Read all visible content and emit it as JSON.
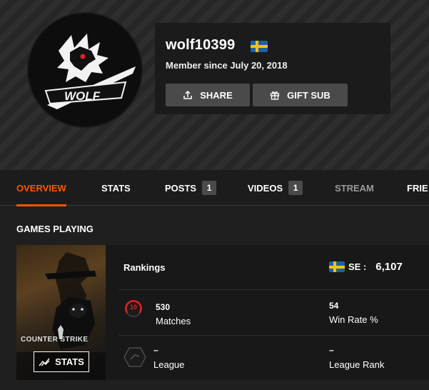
{
  "profile": {
    "username": "wolf10399",
    "member_since": "Member since July 20, 2018",
    "avatar_text": "WOLF",
    "country": "Sweden"
  },
  "actions": {
    "share_label": "SHARE",
    "gift_label": "GIFT SUB"
  },
  "tabs": [
    {
      "label": "OVERVIEW",
      "active": true
    },
    {
      "label": "STATS"
    },
    {
      "label": "POSTS",
      "badge": "1"
    },
    {
      "label": "VIDEOS",
      "badge": "1"
    },
    {
      "label": "STREAM"
    },
    {
      "label": "FRIE"
    }
  ],
  "section": {
    "games_playing": "GAMES PLAYING"
  },
  "game": {
    "cover_logo": "COUNTER STRIKE",
    "stats_label": "STATS",
    "rankings_label": "Rankings",
    "region_code": "SE :",
    "region_value": "6,107",
    "level": "10",
    "matches_value": "530",
    "matches_label": "Matches",
    "win_rate_value": "54",
    "win_rate_label": "Win Rate %",
    "league_value": "–",
    "league_label": "League",
    "league_rank_value": "–",
    "league_rank_label": "League Rank"
  },
  "colors": {
    "accent": "#ff5500",
    "level_red": "#e02020"
  }
}
